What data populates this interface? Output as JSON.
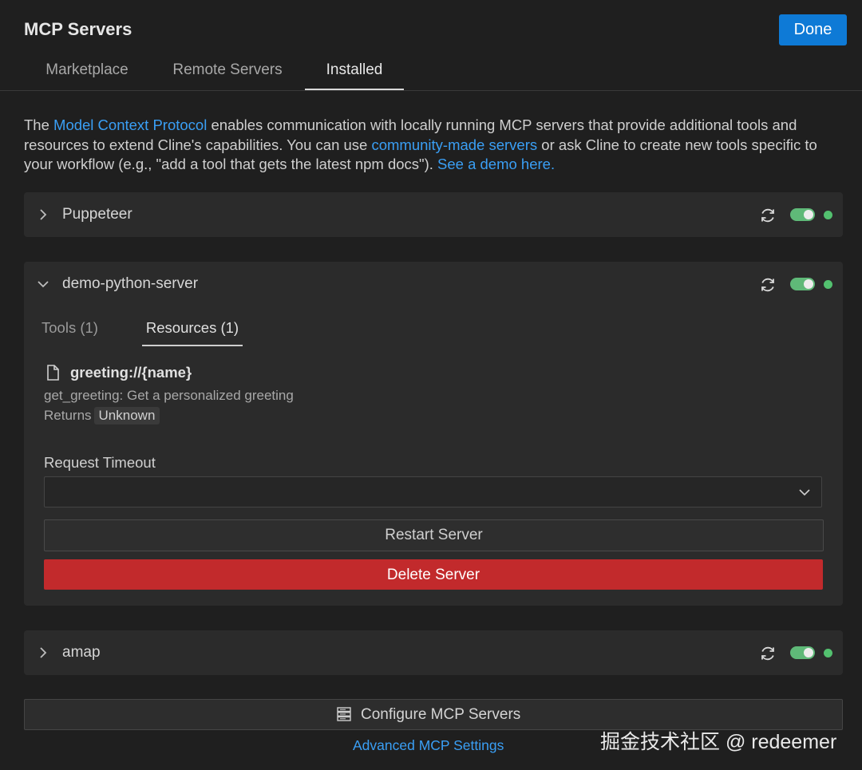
{
  "header": {
    "title": "MCP Servers",
    "done_label": "Done"
  },
  "tabs": [
    {
      "label": "Marketplace",
      "active": false
    },
    {
      "label": "Remote Servers",
      "active": false
    },
    {
      "label": "Installed",
      "active": true
    }
  ],
  "intro": {
    "t1": "The ",
    "link1": "Model Context Protocol",
    "t2": " enables communication with locally running MCP servers that provide additional tools and resources to extend Cline's capabilities. You can use ",
    "link2": "community-made servers",
    "t3": " or ask Cline to create new tools specific to your workflow (e.g., \"add a tool that gets the latest npm docs\"). ",
    "link3": "See a demo here."
  },
  "servers": [
    {
      "name": "Puppeteer",
      "expanded": false,
      "enabled": true,
      "status_color": "#53c16f"
    },
    {
      "name": "demo-python-server",
      "expanded": true,
      "enabled": true,
      "status_color": "#53c16f",
      "subtabs": [
        {
          "label": "Tools (1)",
          "active": false
        },
        {
          "label": "Resources (1)",
          "active": true
        }
      ],
      "resource": {
        "uri": "greeting://{name}",
        "description": "get_greeting: Get a personalized greeting",
        "returns_label": "Returns",
        "returns_value": "Unknown"
      },
      "timeout_label": "Request Timeout",
      "timeout_value": "",
      "restart_label": "Restart Server",
      "delete_label": "Delete Server"
    },
    {
      "name": "amap",
      "expanded": false,
      "enabled": true,
      "status_color": "#53c16f"
    }
  ],
  "footer": {
    "configure_label": "Configure MCP Servers",
    "advanced_label": "Advanced MCP Settings"
  },
  "watermark": "掘金技术社区 @ redeemer",
  "colors": {
    "accent": "#0e7ad6",
    "link": "#3a9ff5",
    "danger": "#c22a2c",
    "toggle_on": "#5fb978",
    "status_ok": "#53c16f"
  }
}
